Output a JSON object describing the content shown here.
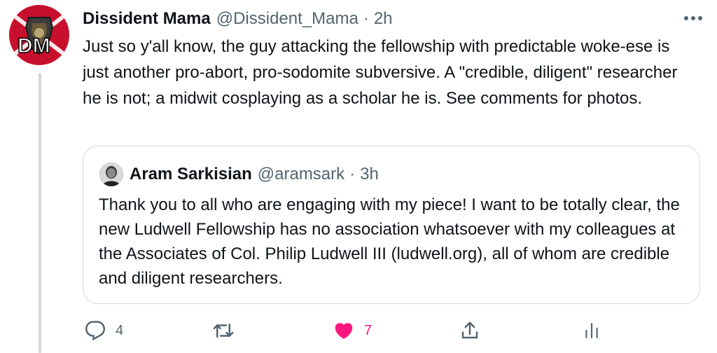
{
  "tweet": {
    "author_name": "Dissident Mama",
    "author_handle": "@Dissident_Mama",
    "separator": "·",
    "time": "2h",
    "avatar_initials": "DM",
    "text": "Just so y'all know, the guy attacking the fellowship with predictable woke-ese is just another pro-abort, pro-sodomite subversive. A \"credible, diligent\" researcher he is not; a midwit cosplaying as a scholar he is. See comments for photos."
  },
  "quoted_tweet": {
    "author_name": "Aram Sarkisian",
    "author_handle": "@aramsark",
    "separator": "·",
    "time": "3h",
    "text": "Thank you to all who are engaging with my piece! I want to be totally clear, the new Ludwell Fellowship has no association whatsoever with my colleagues at the Associates of Col. Philip Ludwell III (ludwell.org), all of whom are credible and diligent researchers."
  },
  "actions": {
    "reply_count": "4",
    "like_count": "7",
    "liked": true
  },
  "icons": {
    "more": "more-horizontal-icon",
    "reply": "reply-icon",
    "retweet": "retweet-icon",
    "like": "heart-filled-icon",
    "share": "share-icon",
    "analytics": "analytics-icon"
  },
  "colors": {
    "text_primary": "#0f1419",
    "text_secondary": "#536471",
    "border": "#cfd9de",
    "like": "#f91880",
    "avatar_red": "#c8102e"
  }
}
